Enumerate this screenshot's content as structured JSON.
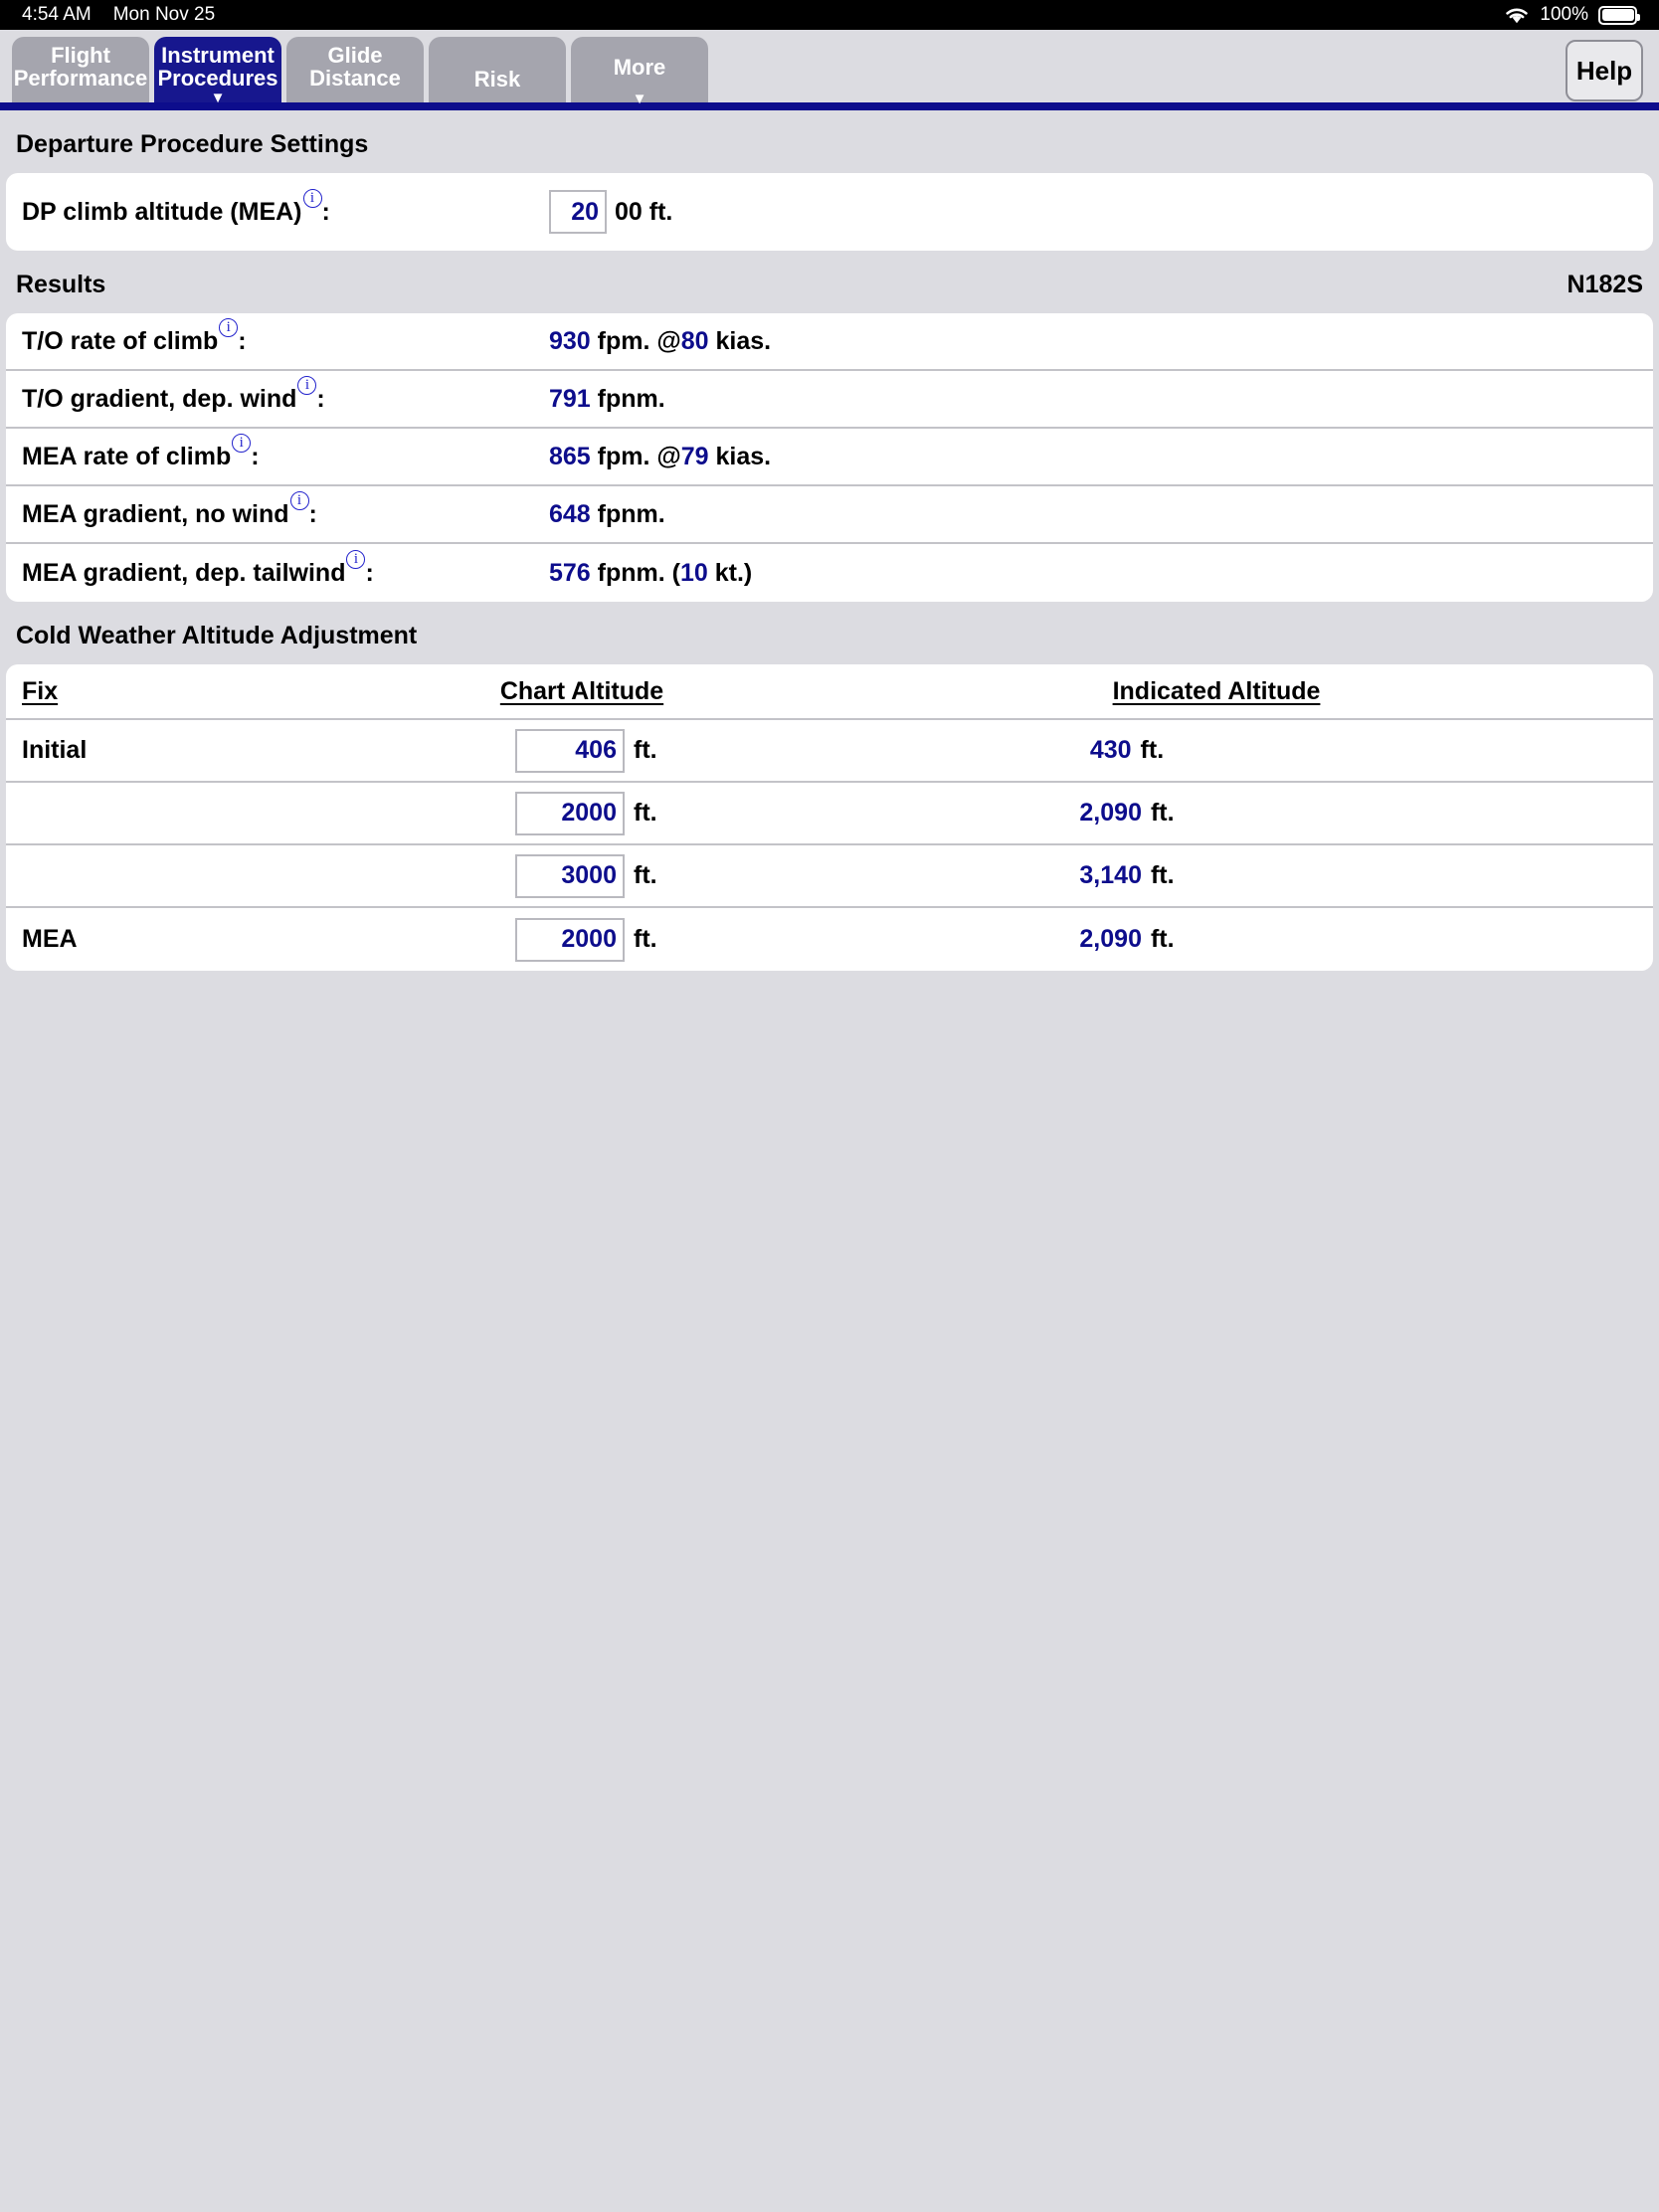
{
  "status_bar": {
    "time": "4:54 AM",
    "date": "Mon Nov 25",
    "wifi_icon": "wifi-icon",
    "battery_percent": "100%",
    "battery_icon": "battery-full-icon"
  },
  "tabs": [
    {
      "line1": "Flight",
      "line2": "Performance",
      "caret": "",
      "active": false
    },
    {
      "line1": "Instrument",
      "line2": "Procedures",
      "caret": "▼",
      "active": true
    },
    {
      "line1": "Glide",
      "line2": "Distance",
      "caret": "",
      "active": false
    },
    {
      "line1": "Risk",
      "line2": "",
      "caret": "",
      "active": false
    },
    {
      "line1": "More",
      "line2": "",
      "caret": "▼",
      "active": false
    }
  ],
  "help_label": "Help",
  "departure": {
    "heading": "Departure Procedure Settings",
    "climb_altitude_label": "DP climb altitude (MEA)",
    "climb_altitude_value": "20",
    "climb_altitude_suffix": "00 ft.",
    "colon": ":"
  },
  "results": {
    "heading": "Results",
    "tail_number": "N182S",
    "rows": [
      {
        "label": "T/O rate of climb",
        "num1": "930",
        "mid": " fpm. @",
        "num2": "80",
        "tail": " kias."
      },
      {
        "label": "T/O gradient, dep. wind",
        "num1": "791",
        "mid": " fpnm.",
        "num2": "",
        "tail": ""
      },
      {
        "label": "MEA rate of climb",
        "num1": "865",
        "mid": " fpm. @",
        "num2": "79",
        "tail": " kias."
      },
      {
        "label": "MEA gradient, no wind",
        "num1": "648",
        "mid": " fpnm.",
        "num2": "",
        "tail": ""
      },
      {
        "label": "MEA gradient, dep. tailwind",
        "num1": "576",
        "mid": " fpnm. (",
        "num2": "10",
        "tail": " kt.)"
      }
    ]
  },
  "cold_weather": {
    "heading": "Cold Weather Altitude Adjustment",
    "columns": {
      "fix": "Fix",
      "chart_altitude": "Chart Altitude",
      "indicated_altitude": "Indicated Altitude"
    },
    "unit": "ft.",
    "rows": [
      {
        "fix": "Initial",
        "chart": "406",
        "indicated": "430"
      },
      {
        "fix": "",
        "chart": "2000",
        "indicated": "2,090"
      },
      {
        "fix": "",
        "chart": "3000",
        "indicated": "3,140"
      },
      {
        "fix": "MEA",
        "chart": "2000",
        "indicated": "2,090"
      }
    ]
  },
  "colors": {
    "accent_blue": "#0d0d8c",
    "tab_active": "#17178e",
    "tab_inactive": "#a5a5ae",
    "page_bg": "#dcdce1"
  }
}
